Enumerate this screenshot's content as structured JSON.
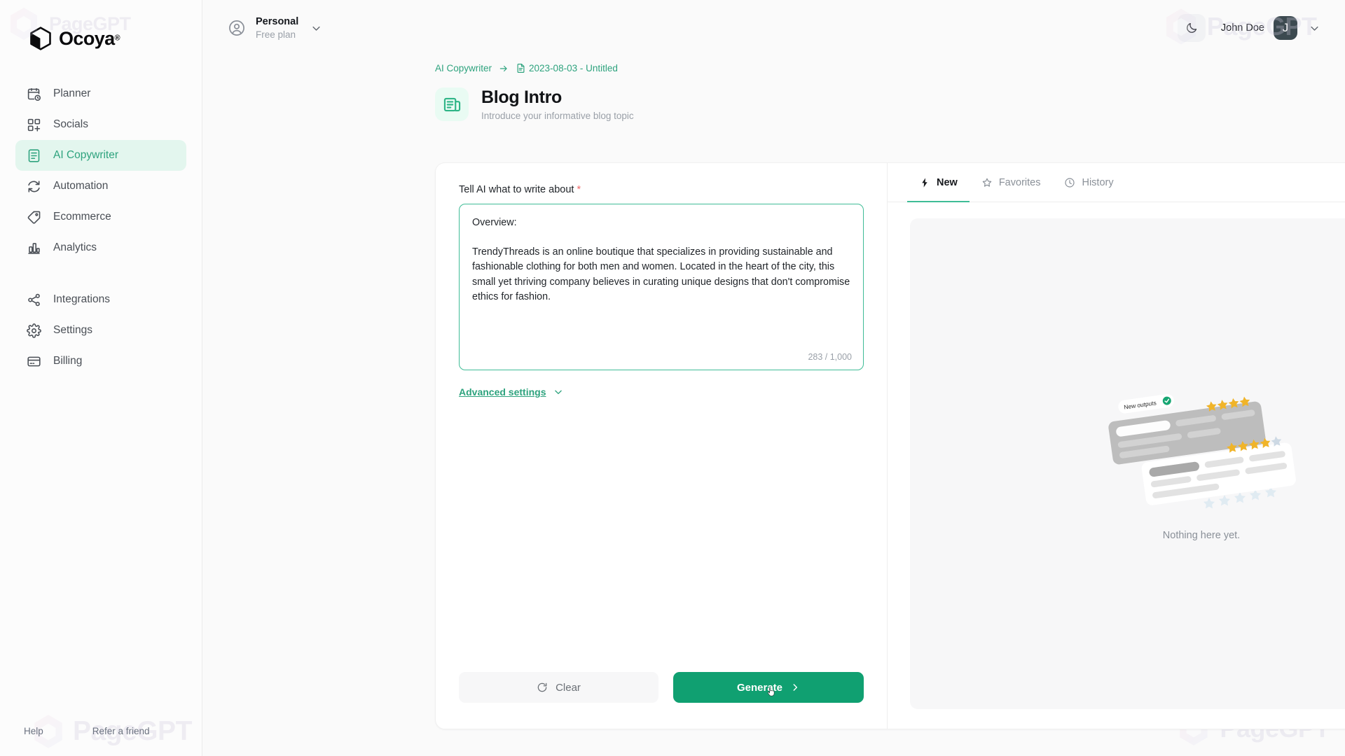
{
  "brand": {
    "name": "Ocoya",
    "registered": "®"
  },
  "sidebar": {
    "groups": [
      {
        "items": [
          {
            "label": "Planner",
            "icon": "calendar-clock-icon",
            "active": false
          },
          {
            "label": "Socials",
            "icon": "grid-plus-icon",
            "active": false
          },
          {
            "label": "AI Copywriter",
            "icon": "document-text-icon",
            "active": true
          },
          {
            "label": "Automation",
            "icon": "refresh-cycle-icon",
            "active": false
          },
          {
            "label": "Ecommerce",
            "icon": "tag-icon",
            "active": false
          },
          {
            "label": "Analytics",
            "icon": "bar-chart-icon",
            "active": false
          }
        ]
      },
      {
        "items": [
          {
            "label": "Integrations",
            "icon": "share-nodes-icon",
            "active": false
          },
          {
            "label": "Settings",
            "icon": "gear-icon",
            "active": false
          },
          {
            "label": "Billing",
            "icon": "credit-card-icon",
            "active": false
          }
        ]
      }
    ],
    "footer": {
      "help": "Help",
      "refer": "Refer a friend"
    }
  },
  "topbar": {
    "workspace": {
      "name": "Personal",
      "plan": "Free plan",
      "icon": "user-circle-icon",
      "chevron": "chevron-down-icon"
    },
    "theme_toggle_icon": "moon-icon",
    "user": {
      "name": "John Doe",
      "initial": "J",
      "chevron": "chevron-down-icon"
    }
  },
  "breadcrumb": {
    "root": "AI Copywriter",
    "separator_icon": "arrow-right-icon",
    "doc_icon": "document-icon",
    "current": "2023-08-03 - Untitled"
  },
  "page": {
    "icon": "blog-intro-icon",
    "title": "Blog Intro",
    "subtitle": "Introduce your informative blog topic"
  },
  "form": {
    "label": "Tell AI what to write about",
    "required_mark": "*",
    "textarea_value": "Overview:\n\nTrendyThreads is an online boutique that specializes in providing sustainable and fashionable clothing for both men and women. Located in the heart of the city, this small yet thriving company believes in curating unique designs that don't compromise ethics for fashion.",
    "textarea_placeholder": "Tell AI what to write about",
    "char_count": "283 / 1,000",
    "advanced_settings": "Advanced settings",
    "advanced_chevron_icon": "chevron-down-icon"
  },
  "actions": {
    "clear_label": "Clear",
    "clear_icon": "refresh-icon",
    "generate_label": "Generate",
    "generate_icon": "chevron-right-icon"
  },
  "output": {
    "tabs": [
      {
        "label": "New",
        "icon": "lightning-icon",
        "active": true
      },
      {
        "label": "Favorites",
        "icon": "star-icon",
        "active": false
      },
      {
        "label": "History",
        "icon": "clock-icon",
        "active": false
      }
    ],
    "empty_text": "Nothing here yet.",
    "illustration_badge": "New outputs"
  },
  "watermark": {
    "text": "PageGPT"
  },
  "colors": {
    "accent_green": "#10a071",
    "accent_green_light": "#3fbc96",
    "sidebar_active_bg": "#e3f6ee",
    "sidebar_active_text": "#2ea37e",
    "page_bg": "#fafafa",
    "card_bg": "#ffffff",
    "muted_text": "#8a9098",
    "required_red": "#ef6b6b"
  }
}
